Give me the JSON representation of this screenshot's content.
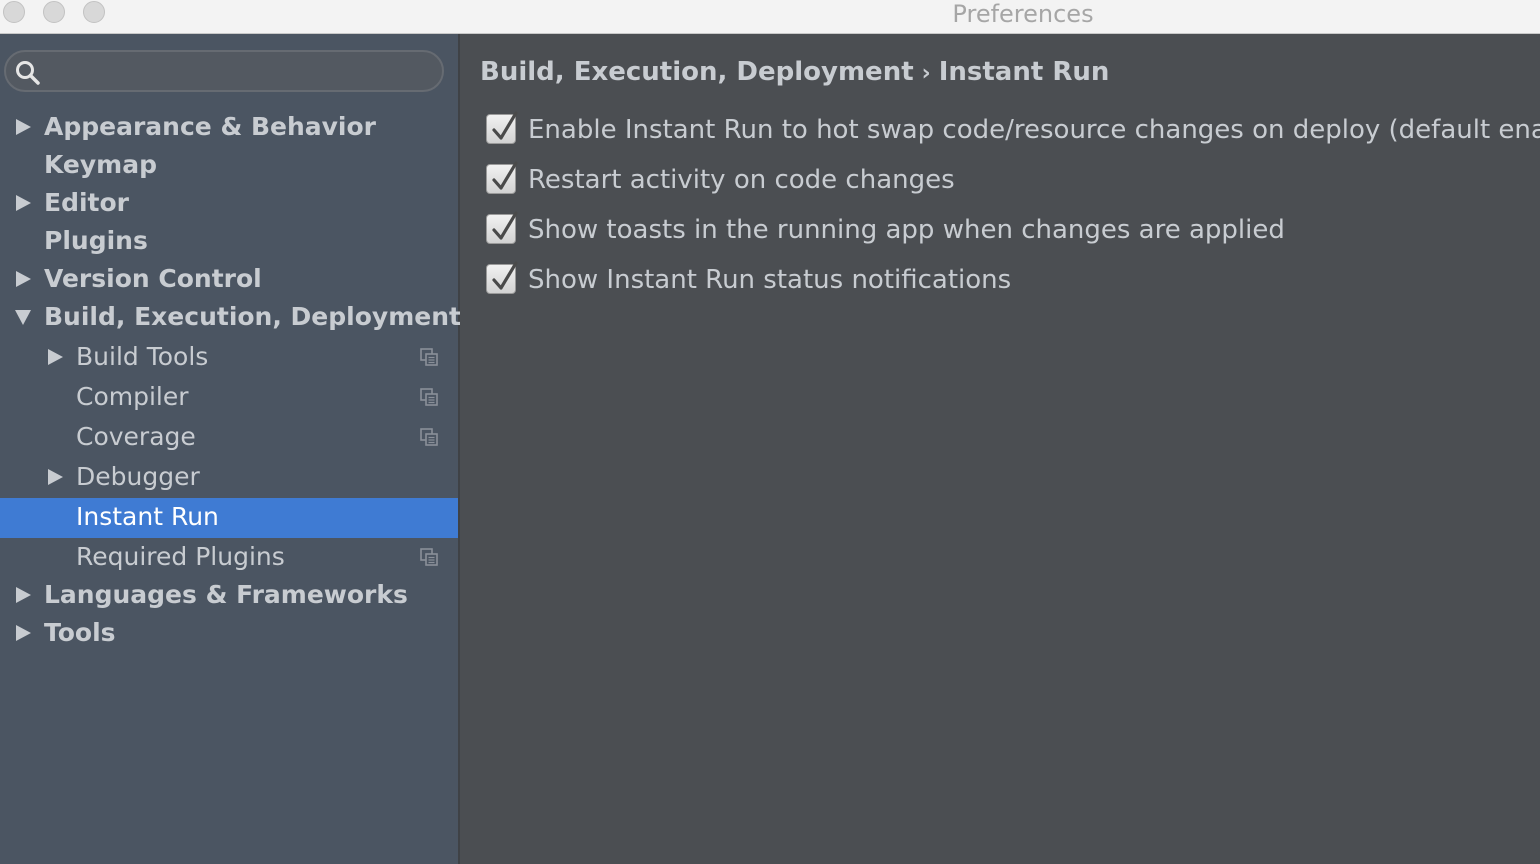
{
  "window": {
    "title": "Preferences"
  },
  "search": {
    "value": "",
    "placeholder": ""
  },
  "sidebar": {
    "items": [
      {
        "label": "Appearance & Behavior",
        "expander": "collapsed",
        "selected": false
      },
      {
        "label": "Keymap",
        "expander": "none",
        "selected": false
      },
      {
        "label": "Editor",
        "expander": "collapsed",
        "selected": false
      },
      {
        "label": "Plugins",
        "expander": "none",
        "selected": false
      },
      {
        "label": "Version Control",
        "expander": "collapsed",
        "selected": false
      },
      {
        "label": "Build, Execution, Deployment",
        "expander": "expanded",
        "selected": false
      },
      {
        "label": "Build Tools",
        "expander": "collapsed",
        "selected": false,
        "project_icon": "copy-icon"
      },
      {
        "label": "Compiler",
        "expander": "none",
        "selected": false,
        "project_icon": "copy-icon"
      },
      {
        "label": "Coverage",
        "expander": "none",
        "selected": false,
        "project_icon": "copy-icon"
      },
      {
        "label": "Debugger",
        "expander": "collapsed",
        "selected": false
      },
      {
        "label": "Instant Run",
        "expander": "none",
        "selected": true
      },
      {
        "label": "Required Plugins",
        "expander": "none",
        "selected": false,
        "project_icon": "copy-icon"
      },
      {
        "label": "Languages & Frameworks",
        "expander": "collapsed",
        "selected": false
      },
      {
        "label": "Tools",
        "expander": "collapsed",
        "selected": false
      }
    ]
  },
  "content": {
    "breadcrumb": {
      "parent": "Build, Execution, Deployment",
      "separator": "›",
      "current": "Instant Run"
    },
    "options": [
      {
        "label": "Enable Instant Run to hot swap code/resource changes on deploy (default enabled)",
        "checked": true
      },
      {
        "label": "Restart activity on code changes",
        "checked": true
      },
      {
        "label": "Show toasts in the running app when changes are applied",
        "checked": true
      },
      {
        "label": "Show Instant Run status notifications",
        "checked": true
      }
    ]
  },
  "colors": {
    "sidebar_bg": "#4b5562",
    "content_bg": "#4b4e52",
    "selection": "#3f7bd3",
    "text": "#c8ccd1"
  }
}
